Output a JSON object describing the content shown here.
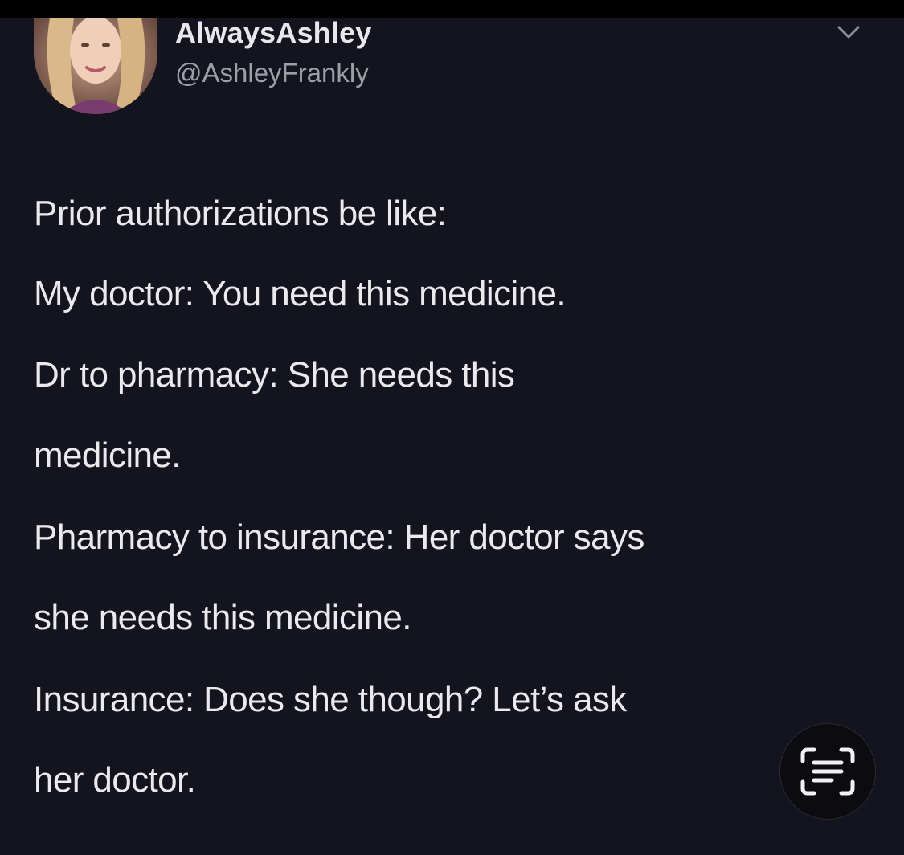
{
  "tweet": {
    "display_name": "AlwaysAshley",
    "handle": "@AshleyFrankly",
    "more_icon": "chevron-down-icon",
    "paragraphs": [
      {
        "lines": [
          "Prior authorizations be like:"
        ]
      },
      {
        "lines": [
          "My doctor: You need this medicine."
        ]
      },
      {
        "lines": [
          "Dr to pharmacy: She needs this",
          "medicine."
        ]
      },
      {
        "lines": [
          "Pharmacy to insurance: Her doctor says",
          "she needs this medicine."
        ]
      },
      {
        "lines": [
          "Insurance: Does she though? Let’s ask",
          "her doctor."
        ]
      }
    ]
  },
  "overlay": {
    "scan_icon": "live-text-scan-icon"
  },
  "colors": {
    "background": "#14141f",
    "text": "#e9e9ee",
    "secondary_text": "#9d9ea6"
  }
}
